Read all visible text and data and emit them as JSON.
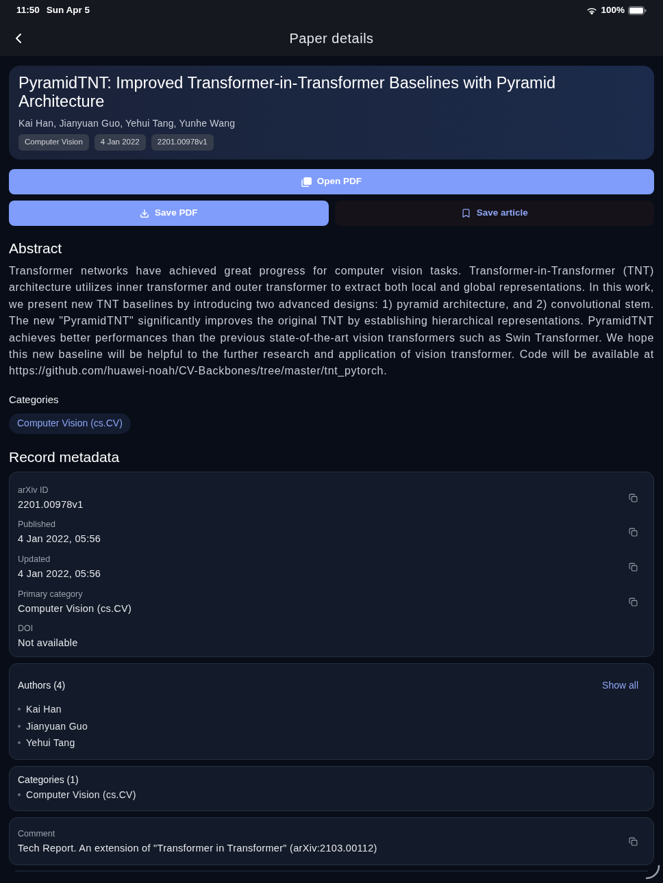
{
  "status_bar": {
    "time": "11:50",
    "date": "Sun Apr 5",
    "battery": "100%"
  },
  "nav": {
    "title": "Paper details"
  },
  "paper": {
    "title": "PyramidTNT: Improved Transformer-in-Transformer Baselines with Pyramid Architecture",
    "authors": "Kai Han, Jianyuan Guo, Yehui Tang, Yunhe Wang",
    "tags": [
      "Computer Vision",
      "4 Jan 2022",
      "2201.00978v1"
    ]
  },
  "actions": {
    "primary": {
      "kind": "open",
      "label": "Open PDF"
    },
    "row": [
      {
        "kind": "download",
        "label": "Save PDF"
      },
      {
        "kind": "bookmark",
        "label": "Save article"
      }
    ]
  },
  "abstract": {
    "heading": "Abstract",
    "text": "Transformer networks have achieved great progress for computer vision tasks. Transformer-in-Transformer (TNT) architecture utilizes inner transformer and outer transformer to extract both local and global representations. In this work, we present new TNT baselines by introducing two advanced designs: 1) pyramid architecture, and 2) convolutional stem. The new \"PyramidTNT\" significantly improves the original TNT by establishing hierarchical representations. PyramidTNT achieves better performances than the previous state-of-the-art vision transformers such as Swin Transformer. We hope this new baseline will be helpful to the further research and application of vision transformer. Code will be available at https://github.com/huawei-noah/CV-Backbones/tree/master/tnt_pytorch."
  },
  "categories": {
    "heading": "Categories",
    "chips": [
      "Computer Vision (cs.CV)"
    ]
  },
  "metadata": {
    "heading": "Record metadata",
    "fields": [
      {
        "label": "arXiv ID",
        "value": "2201.00978v1",
        "copyable": true
      },
      {
        "label": "Published",
        "value": "4 Jan 2022, 05:56",
        "copyable": true
      },
      {
        "label": "Updated",
        "value": "4 Jan 2022, 05:56",
        "copyable": true
      },
      {
        "label": "Primary category",
        "value": "Computer Vision (cs.CV)",
        "copyable": true
      },
      {
        "label": "DOI",
        "value": "Not available",
        "copyable": false
      }
    ]
  },
  "authors_card": {
    "title": "Authors (4)",
    "action": "Show all",
    "items": [
      "Kai Han",
      "Jianyuan Guo",
      "Yehui Tang"
    ]
  },
  "categories_card": {
    "title": "Categories (1)",
    "items": [
      "Computer Vision (cs.CV)"
    ]
  },
  "comment": {
    "label": "Comment",
    "value": "Tech Report. An extension of \"Transformer in Transformer\" (arXiv:2103.00112)",
    "copyable": true
  }
}
